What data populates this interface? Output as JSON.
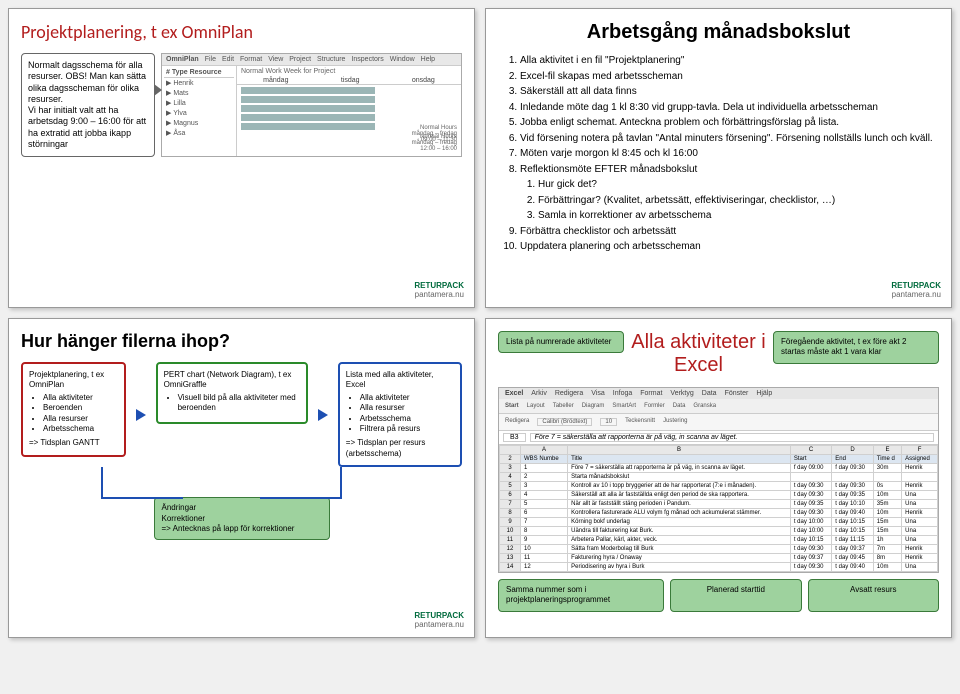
{
  "slide1": {
    "title": "Projektplanering, t ex OmniPlan",
    "callout": "Normalt dagsschema för alla resurser. OBS! Man kan sätta olika dagsscheman för olika resurser.\nVi har initialt valt att ha arbetsdag 9:00 – 16:00 för att ha extratid att jobba ikapp störningar",
    "menu": [
      "OmniPlan",
      "File",
      "Edit",
      "Format",
      "View",
      "Project",
      "Structure",
      "Inspectors",
      "Window",
      "Help"
    ],
    "sideHeader": "# Type    Resource",
    "resources": [
      "▶ Henrik",
      "▶ Mats",
      "▶ Lilla",
      "▶ Ylva",
      "▶ Magnus",
      "▶ Åsa"
    ],
    "ganttCols": [
      "måndag",
      "tisdag",
      "onsdag"
    ],
    "barsLabel1": "Normal Hours\nmåndag – fredag\n09:00 – 11:30",
    "barsLabel2": "Normal Hours\nmåndag – fredag\n12:00 – 16:00"
  },
  "slide2": {
    "title": "Arbetsgång månadsbokslut",
    "items": [
      "Alla aktivitet i en fil \"Projektplanering\"",
      "Excel-fil skapas med arbetsscheman",
      "Säkerställ att all data finns",
      "Inledande möte dag 1 kl 8:30 vid grupp-tavla. Dela ut individuella arbetsscheman",
      "Jobba enligt schemat. Anteckna problem och förbättringsförslag på lista.",
      "Vid försening notera på tavlan \"Antal minuters försening\". Försening nollställs lunch och kväll.",
      "Möten varje morgon kl 8:45 och kl 16:00",
      "Reflektionsmöte EFTER månadsbokslut"
    ],
    "subitems": [
      "Hur gick det?",
      "Förbättringar? (Kvalitet, arbetssätt, effektiviseringar, checklistor, …)",
      "Samla in korrektioner av arbetsschema"
    ],
    "tail": [
      "Förbättra checklistor och arbetssätt",
      "Uppdatera planering och arbetsscheman"
    ]
  },
  "slide3": {
    "title": "Hur hänger filerna ihop?",
    "box1": {
      "title": "Projektplanering, t ex OmniPlan",
      "bullets": [
        "Alla aktiviteter",
        "Beroenden",
        "Alla resurser",
        "Arbetsschema"
      ],
      "foot": "=> Tidsplan GANTT"
    },
    "box2": {
      "title": "PERT chart (Network Diagram), t ex OmniGraffle",
      "bullets": [
        "Visuell bild på alla aktiviteter med beroenden"
      ]
    },
    "box3": {
      "title": "Lista med alla aktiviteter, Excel",
      "bullets": [
        "Alla aktiviteter",
        "Alla resurser",
        "Arbetsschema",
        "Filtrera på resurs"
      ],
      "foot": "=> Tidsplan per resurs (arbetsschema)"
    },
    "changes": {
      "l1": "Ändringar",
      "l2": "Korrektioner",
      "l3": "=> Antecknas på lapp för korrektioner"
    }
  },
  "slide4": {
    "title": "Alla aktiviteter i Excel",
    "leftCallout": "Lista på numrerade aktiviteter",
    "rightCallout": "Föregående aktivitet, t ex före akt 2 startas måste akt 1 vara klar",
    "excel": {
      "appmenu": [
        "Excel",
        "Arkiv",
        "Redigera",
        "Visa",
        "Infoga",
        "Format",
        "Verktyg",
        "Data",
        "Fönster",
        "Hjälp"
      ],
      "ribbon": [
        "Start",
        "Layout",
        "Tabeller",
        "Diagram",
        "SmartArt",
        "Formler",
        "Data",
        "Granska"
      ],
      "ribbonSmall": [
        "Redigera",
        "Teckensnitt",
        "Justering"
      ],
      "font": "Calibri (Brödtext)",
      "fontsize": "10",
      "cell": "B3",
      "formula": "Före 7 = säkerställa att rapporterna är på väg, in scanna av läget.",
      "cols": [
        "",
        "A",
        "B",
        "C",
        "D",
        "E",
        "F"
      ],
      "headers": [
        "",
        "WBS Numbe",
        "Title",
        "Start",
        "End",
        "Time d",
        "Assigned"
      ],
      "rows": [
        [
          "3",
          "1",
          "Före 7 = säkerställa att rapporterna är på väg, in scanna av läget.",
          "f day 09:00",
          "f day 09:30",
          "30m",
          "Henrik"
        ],
        [
          "4",
          "2",
          "Starta månadsbokslut",
          "",
          "",
          "",
          ""
        ],
        [
          "5",
          "3",
          "Kontroll av 10 i topp bryggerier att de har rapporterat (7:e i månaden).",
          "t day 09:30",
          "t day 09:30",
          "0s",
          "Henrik"
        ],
        [
          "6",
          "4",
          "Säkerställ att alla är fastställda enligt den period de ska rapportera.",
          "t day 09:30",
          "t day 09:35",
          "10m",
          "Una"
        ],
        [
          "7",
          "5",
          "När allt är fastställt stäng perioden i Pandum.",
          "t day 09:35",
          "t day 10:10",
          "35m",
          "Una"
        ],
        [
          "8",
          "6",
          "Kontrollera fasturerade ALU volym fg månad och ackumulerat stämmer.",
          "t day 09:30",
          "t day 09:40",
          "10m",
          "Henrik"
        ],
        [
          "9",
          "7",
          "Körning bokf underlag",
          "t day 10:00",
          "t day 10:15",
          "15m",
          "Una"
        ],
        [
          "10",
          "8",
          "Uändra till fakturering kat Burk.",
          "t day 10:00",
          "t day 10:15",
          "15m",
          "Una"
        ],
        [
          "11",
          "9",
          "Arbetera Pallar, kärl, akter, veck.",
          "t day 10:15",
          "t day 11:15",
          "1h",
          "Una"
        ],
        [
          "12",
          "10",
          "Sätta fram Moderbolag till Burk",
          "t day 09:30",
          "t day 09:37",
          "7m",
          "Henrik"
        ],
        [
          "13",
          "11",
          "Fakturering hyra / Onaway",
          "t day 09:37",
          "t day 09:45",
          "8m",
          "Henrik"
        ],
        [
          "14",
          "12",
          "Periodisering av hyra i Burk",
          "t day 09:30",
          "t day 09:40",
          "10m",
          "Una"
        ]
      ]
    },
    "bottom": {
      "left": "Samma nummer som i projektplaneringsprogrammet",
      "mid": "Planerad starttid",
      "right": "Avsatt resurs"
    }
  },
  "logo": {
    "brand": "RETURPACK",
    "sub": "pantamera.nu"
  }
}
